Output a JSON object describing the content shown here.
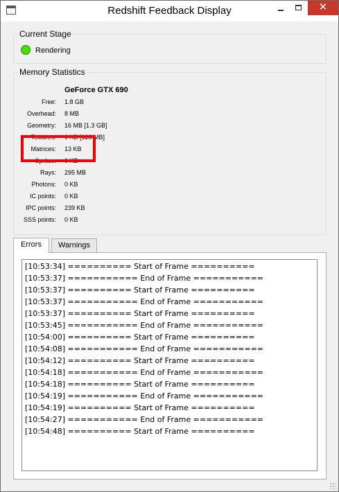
{
  "window": {
    "title": "Redshift Feedback Display",
    "controls": {
      "minimize": "",
      "maximize": "",
      "close": "✕"
    }
  },
  "current_stage": {
    "group_title": "Current Stage",
    "status_text": "Rendering",
    "status_color": "#45e000"
  },
  "memory": {
    "group_title": "Memory Statistics",
    "gpu": "GeForce GTX 690",
    "stats": [
      {
        "label": "Free:",
        "value": "1.8 GB"
      },
      {
        "label": "Overhead:",
        "value": "8 MB"
      },
      {
        "label": "Geometry:",
        "value": "16 MB [1.3 GB]"
      },
      {
        "label": "Textures:",
        "value": "0 KB [128 MB]"
      },
      {
        "label": "Matrices:",
        "value": "13 KB"
      },
      {
        "label": "Sprites:",
        "value": "0 KB"
      },
      {
        "label": "Rays:",
        "value": "295 MB"
      },
      {
        "label": "Photons:",
        "value": "0 KB"
      },
      {
        "label": "IC points:",
        "value": "0 KB"
      },
      {
        "label": "IPC points:",
        "value": "239 KB"
      },
      {
        "label": "SSS points:",
        "value": "0 KB"
      }
    ],
    "highlight_color": "#ee0000"
  },
  "tabs": [
    {
      "label": "Errors",
      "active": true
    },
    {
      "label": "Warnings",
      "active": false
    }
  ],
  "log": [
    "[10:53:34] ========== Start of Frame ==========",
    "[10:53:37] =========== End of Frame ===========",
    "[10:53:37] ========== Start of Frame ==========",
    "[10:53:37] =========== End of Frame ===========",
    "[10:53:37] ========== Start of Frame ==========",
    "[10:53:45] =========== End of Frame ===========",
    "[10:54:00] ========== Start of Frame ==========",
    "[10:54:08] =========== End of Frame ===========",
    "[10:54:12] ========== Start of Frame ==========",
    "[10:54:18] =========== End of Frame ===========",
    "[10:54:18] ========== Start of Frame ==========",
    "[10:54:19] =========== End of Frame ===========",
    "[10:54:19] ========== Start of Frame ==========",
    "[10:54:27] =========== End of Frame ===========",
    "[10:54:48] ========== Start of Frame =========="
  ]
}
